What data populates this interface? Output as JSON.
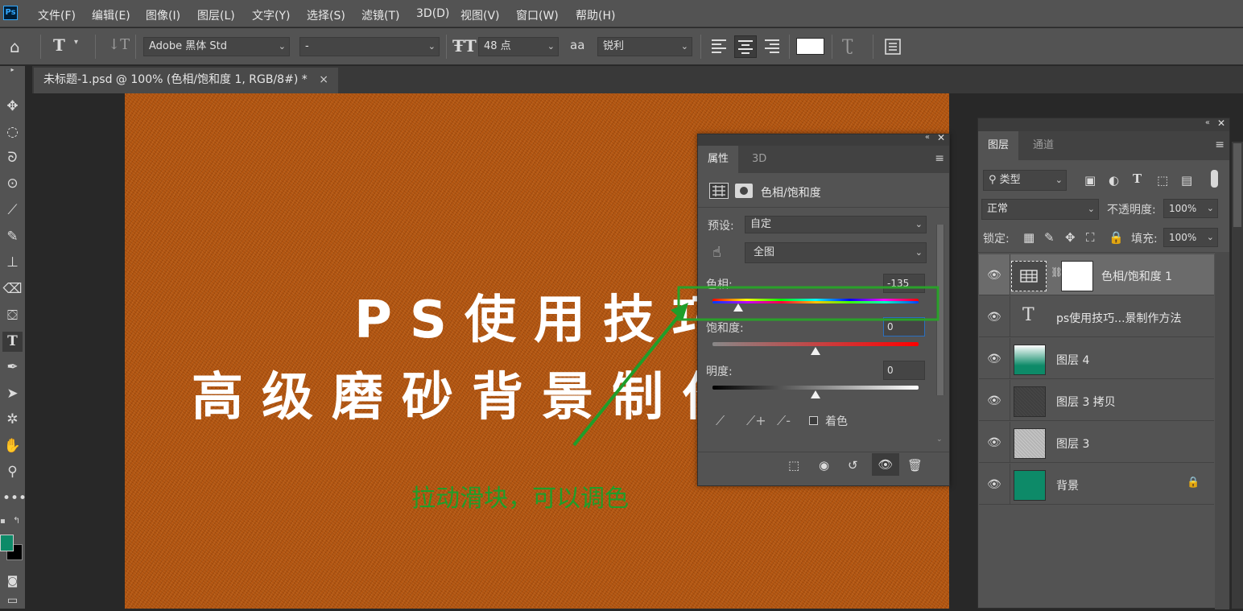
{
  "menubar": {
    "logo": "Ps",
    "items": [
      "文件(F)",
      "编辑(E)",
      "图像(I)",
      "图层(L)",
      "文字(Y)",
      "选择(S)",
      "滤镜(T)",
      "3D(D)",
      "视图(V)",
      "窗口(W)",
      "帮助(H)"
    ]
  },
  "options": {
    "font_family": "Adobe 黑体 Std",
    "font_style": "-",
    "font_size": "48 点",
    "aa_label": "aa",
    "antialias": "锐利"
  },
  "document": {
    "tab_title": "未标题-1.psd @ 100% (色相/饱和度 1, RGB/8#) *",
    "close": "×"
  },
  "canvas": {
    "line1": "PS使用技巧",
    "line2": "高级磨砂背景制作",
    "annotation": "拉动滑块，可以调色",
    "annotation_color": "#1f9e2a",
    "background_color": "#b0530f"
  },
  "properties": {
    "tab_active": "属性",
    "tab_other": "3D",
    "adjustment_title": "色相/饱和度",
    "preset_label": "预设:",
    "preset_value": "自定",
    "channel_value": "全图",
    "hue_label": "色相:",
    "hue_value": "-135",
    "hue_fraction": 0.125,
    "saturation_label": "饱和度:",
    "saturation_value": "0",
    "saturation_fraction": 0.5,
    "lightness_label": "明度:",
    "lightness_value": "0",
    "lightness_fraction": 0.5,
    "colorize_label": "着色"
  },
  "layers_panel": {
    "tab_active": "图层",
    "tab_other": "通道",
    "filter_label": "类型",
    "blend_mode": "正常",
    "opacity_label": "不透明度:",
    "opacity_value": "100%",
    "lock_label": "锁定:",
    "fill_label": "填充:",
    "fill_value": "100%",
    "layers": [
      {
        "name": "色相/饱和度 1",
        "kind": "adjustment",
        "selected": true
      },
      {
        "name": "ps使用技巧...景制作方法",
        "kind": "text"
      },
      {
        "name": "图层 4",
        "kind": "gradient"
      },
      {
        "name": "图层 3 拷贝",
        "kind": "noise-dark"
      },
      {
        "name": "图层 3",
        "kind": "noise-light"
      },
      {
        "name": "背景",
        "kind": "fill",
        "locked": true
      }
    ]
  },
  "colors": {
    "foreground": "#0d8a68",
    "background": "#000000",
    "accent": "#31a8ff"
  }
}
